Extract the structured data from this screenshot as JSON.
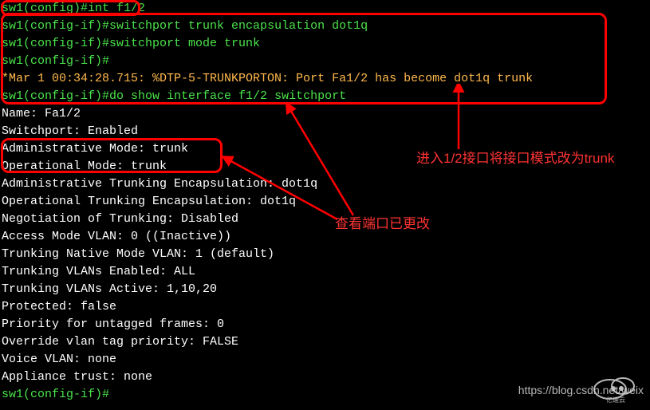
{
  "terminal": {
    "lines": [
      {
        "segments": [
          {
            "text": "sw1(config)#",
            "cls": "green"
          },
          {
            "text": "int f1/2",
            "cls": "green"
          }
        ]
      },
      {
        "segments": [
          {
            "text": "sw1(config-if)#",
            "cls": "green"
          },
          {
            "text": "switchport trunk encapsulation dot1q",
            "cls": "green"
          }
        ]
      },
      {
        "segments": [
          {
            "text": "sw1(config-if)#",
            "cls": "green"
          },
          {
            "text": "switchport mode trunk",
            "cls": "green"
          }
        ]
      },
      {
        "segments": [
          {
            "text": "sw1(config-if)#",
            "cls": "green"
          }
        ]
      },
      {
        "segments": [
          {
            "text": "*Mar  1 00:34:28.715: %DTP-5-TRUNKPORTON: Port Fa1/2 has become dot1q trunk",
            "cls": "orange"
          }
        ]
      },
      {
        "segments": [
          {
            "text": "sw1(config-if)#",
            "cls": "green"
          },
          {
            "text": "do show interface f1/2 switchport",
            "cls": "green"
          }
        ]
      },
      {
        "segments": [
          {
            "text": "Name: Fa1/2",
            "cls": "white"
          }
        ]
      },
      {
        "segments": [
          {
            "text": "Switchport: Enabled",
            "cls": "white"
          }
        ]
      },
      {
        "segments": [
          {
            "text": "Administrative Mode: trunk",
            "cls": "white"
          }
        ]
      },
      {
        "segments": [
          {
            "text": "Operational Mode: trunk",
            "cls": "white"
          }
        ]
      },
      {
        "segments": [
          {
            "text": "Administrative Trunking Encapsulation: dot1q",
            "cls": "white"
          }
        ]
      },
      {
        "segments": [
          {
            "text": "Operational Trunking Encapsulation: dot1q",
            "cls": "white"
          }
        ]
      },
      {
        "segments": [
          {
            "text": "Negotiation of Trunking: Disabled",
            "cls": "white"
          }
        ]
      },
      {
        "segments": [
          {
            "text": "Access Mode VLAN: 0 ((Inactive))",
            "cls": "white"
          }
        ]
      },
      {
        "segments": [
          {
            "text": "Trunking Native Mode VLAN: 1 (default)",
            "cls": "white"
          }
        ]
      },
      {
        "segments": [
          {
            "text": "Trunking VLANs Enabled: ALL",
            "cls": "white"
          }
        ]
      },
      {
        "segments": [
          {
            "text": "Trunking VLANs Active: 1,10,20",
            "cls": "white"
          }
        ]
      },
      {
        "segments": [
          {
            "text": "Protected: false",
            "cls": "white"
          }
        ]
      },
      {
        "segments": [
          {
            "text": "Priority for untagged frames: 0",
            "cls": "white"
          }
        ]
      },
      {
        "segments": [
          {
            "text": "Override vlan tag priority: FALSE",
            "cls": "white"
          }
        ]
      },
      {
        "segments": [
          {
            "text": "Voice VLAN: none",
            "cls": "white"
          }
        ]
      },
      {
        "segments": [
          {
            "text": "Appliance trust: none",
            "cls": "white"
          }
        ]
      },
      {
        "segments": [
          {
            "text": "sw1(config-if)#",
            "cls": "green"
          }
        ]
      }
    ]
  },
  "annotations": {
    "anno1": "进入1/2接口将接口模式改为trunk",
    "anno2": "查看端口已更改"
  },
  "watermark": "https://blog.csdn.net/weix",
  "logo_text": "亿速云"
}
